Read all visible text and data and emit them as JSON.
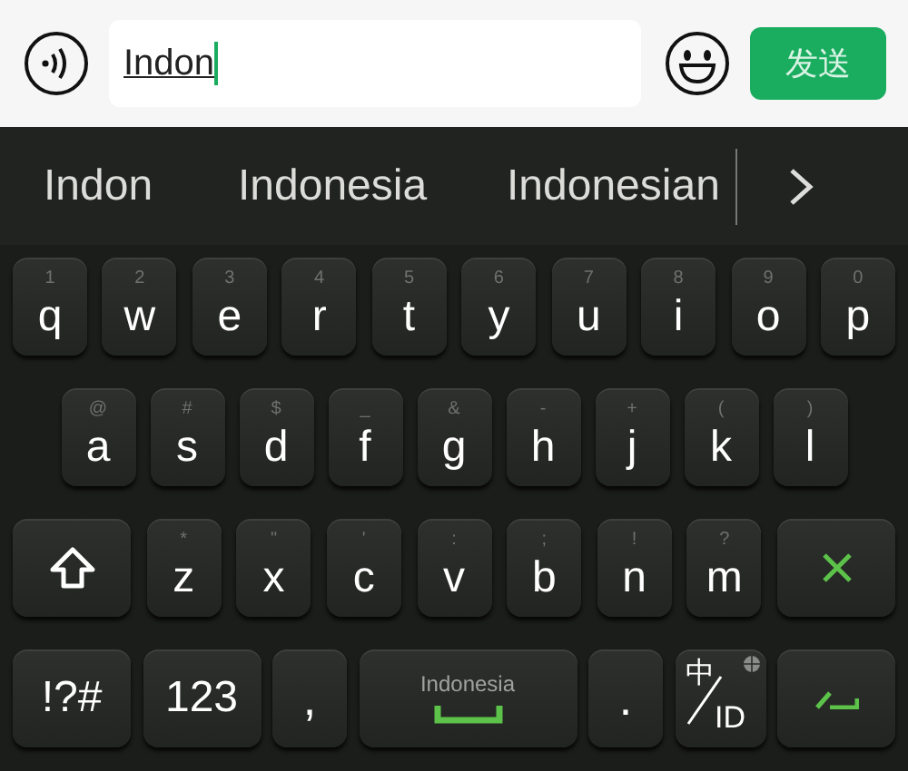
{
  "composer": {
    "value": "Indon",
    "send_button": "发送"
  },
  "suggestions": {
    "items": [
      "Indon",
      "Indonesia",
      "Indonesian"
    ]
  },
  "keyboard": {
    "rows": [
      {
        "keys": [
          {
            "kind": "letter",
            "label": "q",
            "hint": "1"
          },
          {
            "kind": "letter",
            "label": "w",
            "hint": "2"
          },
          {
            "kind": "letter",
            "label": "e",
            "hint": "3"
          },
          {
            "kind": "letter",
            "label": "r",
            "hint": "4"
          },
          {
            "kind": "letter",
            "label": "t",
            "hint": "5"
          },
          {
            "kind": "letter",
            "label": "y",
            "hint": "6"
          },
          {
            "kind": "letter",
            "label": "u",
            "hint": "7"
          },
          {
            "kind": "letter",
            "label": "i",
            "hint": "8"
          },
          {
            "kind": "letter",
            "label": "o",
            "hint": "9"
          },
          {
            "kind": "letter",
            "label": "p",
            "hint": "0"
          }
        ]
      },
      {
        "keys": [
          {
            "kind": "letter",
            "label": "a",
            "hint": "@"
          },
          {
            "kind": "letter",
            "label": "s",
            "hint": "#"
          },
          {
            "kind": "letter",
            "label": "d",
            "hint": "$"
          },
          {
            "kind": "letter",
            "label": "f",
            "hint": "_"
          },
          {
            "kind": "letter",
            "label": "g",
            "hint": "&"
          },
          {
            "kind": "letter",
            "label": "h",
            "hint": "-"
          },
          {
            "kind": "letter",
            "label": "j",
            "hint": "+"
          },
          {
            "kind": "letter",
            "label": "k",
            "hint": "("
          },
          {
            "kind": "letter",
            "label": "l",
            "hint": ")"
          }
        ]
      },
      {
        "keys": [
          {
            "kind": "shift"
          },
          {
            "kind": "letter",
            "label": "z",
            "hint": "*"
          },
          {
            "kind": "letter",
            "label": "x",
            "hint": "\""
          },
          {
            "kind": "letter",
            "label": "c",
            "hint": "'"
          },
          {
            "kind": "letter",
            "label": "v",
            "hint": ":"
          },
          {
            "kind": "letter",
            "label": "b",
            "hint": ";"
          },
          {
            "kind": "letter",
            "label": "n",
            "hint": "!"
          },
          {
            "kind": "letter",
            "label": "m",
            "hint": "?"
          },
          {
            "kind": "delete"
          }
        ]
      },
      {
        "keys": [
          {
            "kind": "wide",
            "label": "!?#"
          },
          {
            "kind": "wide",
            "label": "123"
          },
          {
            "kind": "punct",
            "label": ","
          },
          {
            "kind": "space",
            "label": "Indonesia"
          },
          {
            "kind": "punct",
            "label": "."
          },
          {
            "kind": "lang",
            "label": "中",
            "sub": "ID"
          },
          {
            "kind": "enter"
          }
        ]
      }
    ]
  }
}
